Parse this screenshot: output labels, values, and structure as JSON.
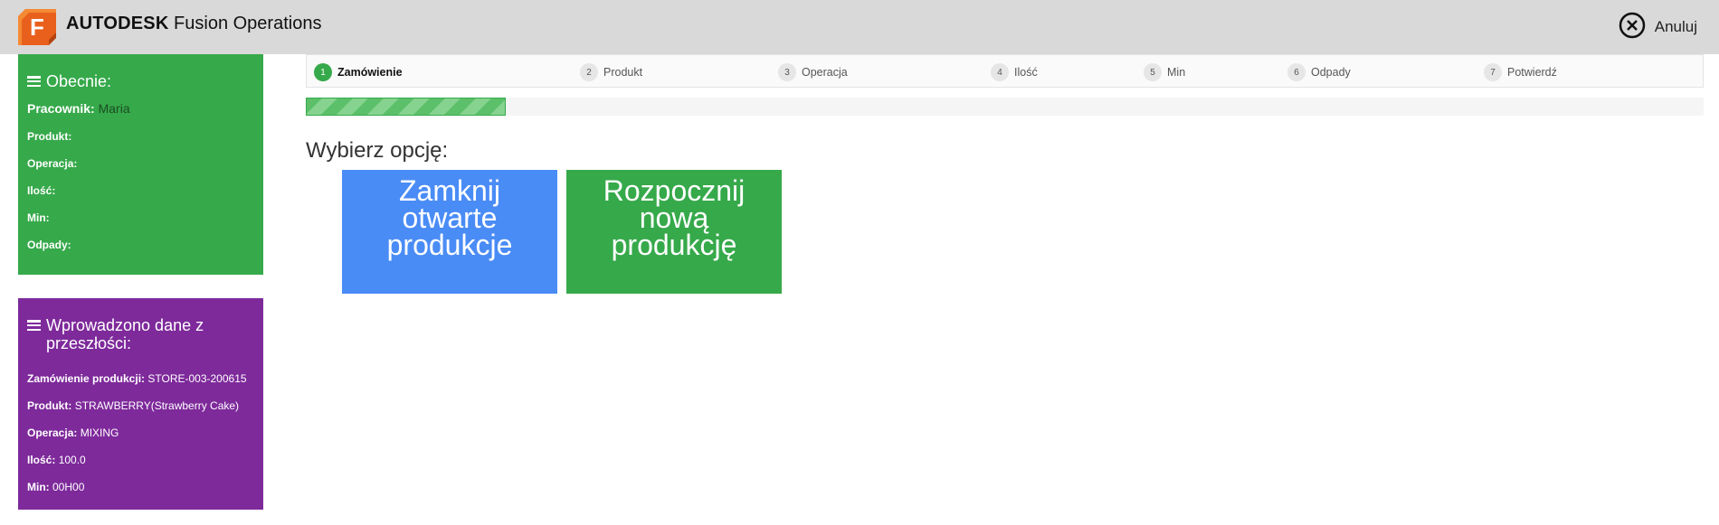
{
  "header": {
    "brand_strong": "AUTODESK",
    "brand_rest": "Fusion Operations",
    "cancel_label": "Anuluj",
    "logo_letter": "F",
    "logo_icon": "fusion-logo-icon",
    "cancel_icon": "close-circle-icon"
  },
  "current": {
    "title": "Obecnie:",
    "worker_label": "Pracownik:",
    "worker_value": "Maria",
    "fields": [
      {
        "label": "Produkt:",
        "value": ""
      },
      {
        "label": "Operacja:",
        "value": ""
      },
      {
        "label": "Ilość:",
        "value": ""
      },
      {
        "label": "Min:",
        "value": ""
      },
      {
        "label": "Odpady:",
        "value": ""
      }
    ]
  },
  "past": {
    "title": "Wprowadzono dane z przeszłości:",
    "fields": [
      {
        "label": "Zamówienie produkcji:",
        "value": "STORE-003-200615"
      },
      {
        "label": "Produkt:",
        "value": "STRAWBERRY(Strawberry Cake)"
      },
      {
        "label": "Operacja:",
        "value": "MIXING"
      },
      {
        "label": "Ilość:",
        "value": "100.0"
      },
      {
        "label": "Min:",
        "value": "00H00"
      }
    ]
  },
  "steps": [
    {
      "num": "1",
      "label": "Zamówienie"
    },
    {
      "num": "2",
      "label": "Produkt"
    },
    {
      "num": "3",
      "label": "Operacja"
    },
    {
      "num": "4",
      "label": "Ilość"
    },
    {
      "num": "5",
      "label": "Min"
    },
    {
      "num": "6",
      "label": "Odpady"
    },
    {
      "num": "7",
      "label": "Potwierdź"
    }
  ],
  "progress": {
    "current_step": 1,
    "total_steps": 7,
    "fraction": 0.143
  },
  "prompt": "Wybierz opcję:",
  "options": [
    {
      "lines": [
        "Zamknij",
        "otwarte",
        "produkcje"
      ]
    },
    {
      "lines": [
        "Rozpocznij",
        "nową",
        "produkcję"
      ]
    }
  ],
  "colors": {
    "green": "#36a94a",
    "purple": "#7e2a9b",
    "blue": "#4a8cf6",
    "header_bg": "#d9d9d9"
  }
}
